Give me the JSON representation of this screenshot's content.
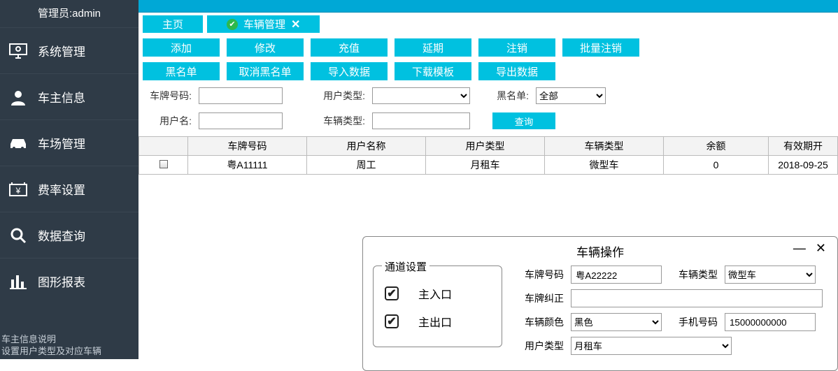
{
  "admin_label": "管理员:admin",
  "sidebar": {
    "items": [
      {
        "label": "系统管理"
      },
      {
        "label": "车主信息"
      },
      {
        "label": "车场管理"
      },
      {
        "label": "费率设置"
      },
      {
        "label": "数据查询"
      },
      {
        "label": "图形报表"
      }
    ],
    "footer_line1": "车主信息说明",
    "footer_line2": "设置用户类型及对应车辆"
  },
  "tabs": {
    "home": "主页",
    "vehicle_mgmt": "车辆管理"
  },
  "actions": {
    "add": "添加",
    "edit": "修改",
    "recharge": "充值",
    "extend": "延期",
    "cancel": "注销",
    "batch_cancel": "批量注销",
    "blacklist": "黑名单",
    "remove_blacklist": "取消黑名单",
    "import": "导入数据",
    "download_tpl": "下载模板",
    "export": "导出数据"
  },
  "filters": {
    "plate_label": "车牌号码:",
    "plate_value": "",
    "user_type_label": "用户类型:",
    "user_type_value": "",
    "blacklist_label": "黑名单:",
    "blacklist_value": "全部",
    "username_label": "用户名:",
    "username_value": "",
    "vehicle_type_label": "车辆类型:",
    "vehicle_type_value": "",
    "query": "查询"
  },
  "grid": {
    "headers": {
      "plate": "车牌号码",
      "user": "用户名称",
      "utype": "用户类型",
      "vtype": "车辆类型",
      "balance": "余额",
      "valid": "有效期开"
    },
    "rows": [
      {
        "plate": "粤A11111",
        "user": "周工",
        "utype": "月租车",
        "vtype": "微型车",
        "balance": "0",
        "valid": "2018-09-25"
      }
    ]
  },
  "dialog": {
    "title": "车辆操作",
    "channel_title": "通道设置",
    "channel_in": "主入口",
    "channel_out": "主出口",
    "plate_label": "车牌号码",
    "plate_value": "粤A22222",
    "vtype_label": "车辆类型",
    "vtype_value": "微型车",
    "correct_label": "车牌纠正",
    "correct_value": "",
    "color_label": "车辆颜色",
    "color_value": "黑色",
    "phone_label": "手机号码",
    "phone_value": "15000000000",
    "utype_label": "用户类型",
    "utype_value": "月租车"
  }
}
